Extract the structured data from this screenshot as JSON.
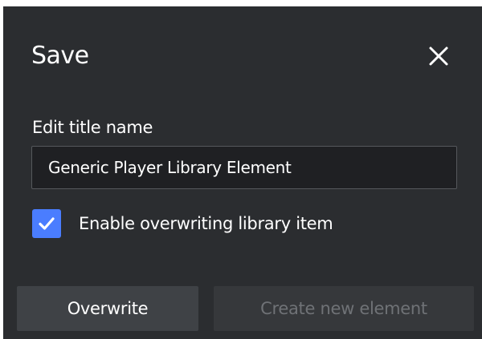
{
  "dialog": {
    "title": "Save",
    "close_icon": "close-icon",
    "field": {
      "label": "Edit title name",
      "value": "Generic Player Library Element"
    },
    "checkbox": {
      "label": "Enable overwriting library item",
      "checked": true,
      "icon": "checkmark-icon"
    },
    "buttons": {
      "overwrite_label": "Overwrite",
      "create_label": "Create new element"
    }
  },
  "colors": {
    "background": "#2b2d30",
    "input_background": "#1f2023",
    "accent": "#4a7dff",
    "button_primary": "#3f4246",
    "button_disabled": "#36383b",
    "text": "#ffffff",
    "text_disabled": "#6f7276"
  }
}
